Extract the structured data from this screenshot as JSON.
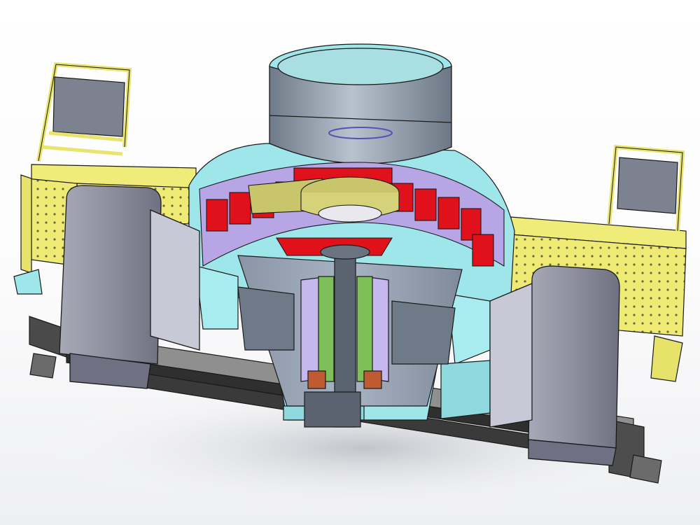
{
  "window": {
    "title": ""
  },
  "view": {
    "mode": "section-view",
    "shading": "shaded-with-edges"
  },
  "model": {
    "name": ""
  },
  "colors": {
    "background": "#ffffff",
    "edge": "#1a1a1a",
    "frame_yellow": "#f0ec7a",
    "body_cyan": "#9fe6ea",
    "hopper_steel": "#7f8a99",
    "motor_gray": "#8d8f9e",
    "rotor_red": "#e0111b",
    "rotor_olive": "#c9c56b",
    "shaft_steel": "#5a6470",
    "shaft_green": "#7fbf5a",
    "liner_violet": "#c4b8ee",
    "base_black": "#3a3a3a"
  },
  "icons": []
}
